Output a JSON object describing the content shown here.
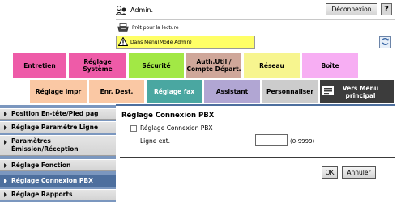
{
  "header": {
    "user": "Admin.",
    "logout_label": "Déconnexion",
    "help_label": "?",
    "status_text": "Prêt pour la lecture",
    "warning_text": "Dans Menu(Mode Admin)"
  },
  "tabs_row1": [
    {
      "label": "Entretien",
      "color": "#ee5ba8"
    },
    {
      "label": "Réglage Système",
      "color": "#ee5ba8"
    },
    {
      "label": "Sécurité",
      "color": "#a2e845"
    },
    {
      "label": "Auth.Util / Compte Départ.",
      "color": "#cfa79a"
    },
    {
      "label": "Réseau",
      "color": "#f7f58f"
    },
    {
      "label": "Boîte",
      "color": "#f7aef3"
    }
  ],
  "tabs_row2": [
    {
      "label": "Réglage impr",
      "color": "#fac8a4"
    },
    {
      "label": "Enr. Dest.",
      "color": "#fac8a4"
    },
    {
      "label": "Réglage fax",
      "color": "#4aa7a1"
    },
    {
      "label": "Assistant",
      "color": "#b1a6d3"
    },
    {
      "label": "Personnaliser",
      "color": "#cccccc"
    },
    {
      "label": "Vers Menu principal",
      "color": "#3c3c3c"
    }
  ],
  "sidebar": {
    "items": [
      {
        "label": "Position En-tête/Pied pag"
      },
      {
        "label": "Réglage Paramètre Ligne"
      },
      {
        "label": "Paramètres Émission/Réception"
      },
      {
        "label": "Réglage Fonction"
      },
      {
        "label": "Réglage Connexion PBX"
      },
      {
        "label": "Réglage Rapports"
      }
    ]
  },
  "main": {
    "title": "Réglage Connexion PBX",
    "checkbox_label": "Réglage Connexion PBX",
    "line_label": "Ligne ext.",
    "line_value": "",
    "range_hint": "(0-9999)",
    "ok_label": "OK",
    "cancel_label": "Annuler"
  }
}
